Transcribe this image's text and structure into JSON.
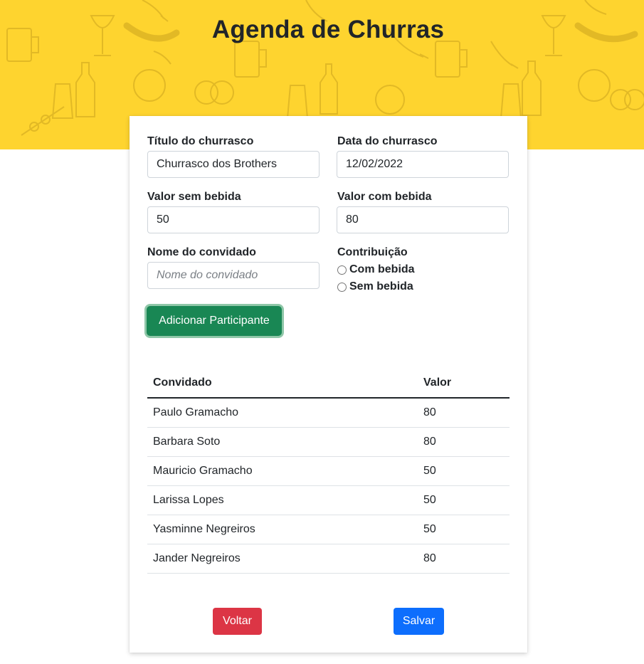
{
  "header": {
    "title": "Agenda de Churras"
  },
  "form": {
    "title_label": "Título do churrasco",
    "title_value": "Churrasco dos Brothers",
    "date_label": "Data do churrasco",
    "date_value": "12/02/2022",
    "price_no_drink_label": "Valor sem bebida",
    "price_no_drink_value": "50",
    "price_drink_label": "Valor com bebida",
    "price_drink_value": "80",
    "guest_label": "Nome do convidado",
    "guest_placeholder": "Nome do convidado",
    "contribution_label": "Contribuição",
    "contribution_options": [
      "Com bebida",
      "Sem bebida"
    ],
    "add_button": "Adicionar Participante"
  },
  "table": {
    "headers": [
      "Convidado",
      "Valor"
    ],
    "rows": [
      {
        "name": "Paulo Gramacho",
        "value": "80"
      },
      {
        "name": "Barbara Soto",
        "value": "80"
      },
      {
        "name": "Mauricio Gramacho",
        "value": "50"
      },
      {
        "name": "Larissa Lopes",
        "value": "50"
      },
      {
        "name": "Yasminne Negreiros",
        "value": "50"
      },
      {
        "name": "Jander Negreiros",
        "value": "80"
      }
    ]
  },
  "actions": {
    "back": "Voltar",
    "save": "Salvar"
  },
  "colors": {
    "banner": "#fed42f",
    "add": "#198754",
    "back": "#dc3545",
    "save": "#0d6efd"
  }
}
